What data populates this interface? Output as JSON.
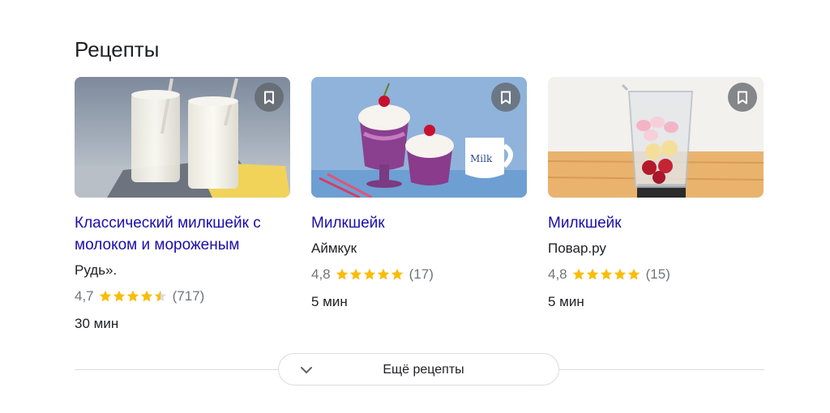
{
  "section": {
    "title": "Рецепты"
  },
  "recipes": [
    {
      "title_line1": "Классический милкшейк с",
      "title_line2": "молоком и мороженым",
      "source": "Рудь».",
      "rating": "4,7",
      "rating_value": 4.7,
      "reviews": "(717)",
      "time": "30 мин",
      "image_icon": "milkshake-glasses-photo"
    },
    {
      "title_line1": "Милкшейк",
      "title_line2": "",
      "source": "Аймкук",
      "rating": "4,8",
      "rating_value": 4.8,
      "reviews": "(17)",
      "time": "5 мин",
      "image_icon": "berry-milkshake-photo"
    },
    {
      "title_line1": "Милкшейк",
      "title_line2": "",
      "source": "Повар.ру",
      "rating": "4,8",
      "rating_value": 4.8,
      "reviews": "(15)",
      "time": "5 мин",
      "image_icon": "blender-cup-photo"
    }
  ],
  "more": {
    "label": "Ещё рецепты",
    "icon": "chevron-down-icon"
  },
  "colors": {
    "link": "#1a0dab",
    "star": "#fbbc04",
    "muted": "#70757a",
    "text": "#202124",
    "divider": "#dadce0"
  }
}
